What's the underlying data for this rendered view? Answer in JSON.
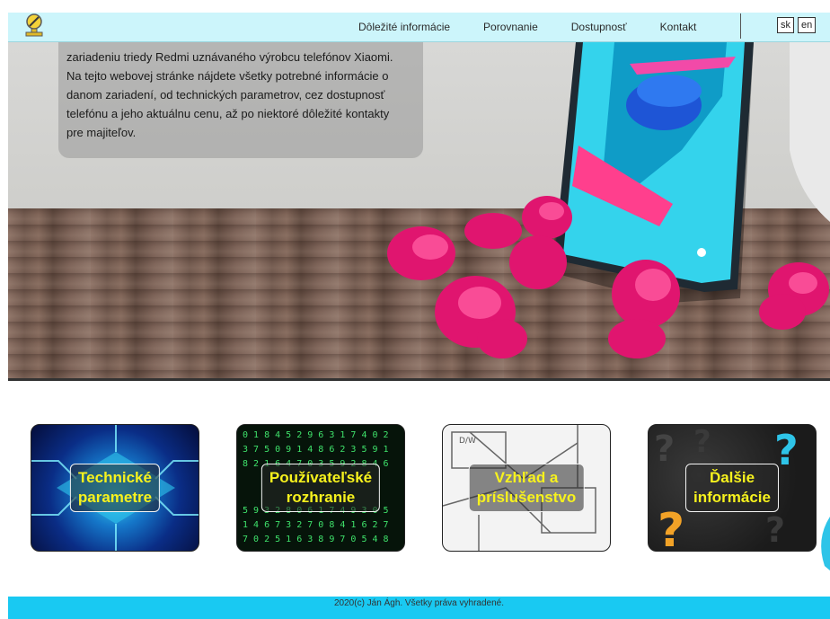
{
  "nav": {
    "links": [
      "Dôležité informácie",
      "Porovnanie",
      "Dostupnosť",
      "Kontakt"
    ],
    "languages": [
      "sk",
      "en"
    ]
  },
  "hero": {
    "intro_lines": [
      "zariadeniu triedy Redmi uznávaného výrobcu telefónov Xiaomi.",
      "Na tejto webovej stránke nájdete všetky potrebné informácie o",
      "danom zariadení, od technických parametrov, cez dostupnosť",
      "telefónu a jeho aktuálnu cenu, až po niektoré dôležité kontakty",
      "pre majiteľov."
    ]
  },
  "cards": [
    {
      "line1": "Technické",
      "line2": "parametre"
    },
    {
      "line1": "Používateľské",
      "line2": "rozhranie"
    },
    {
      "line1": "Vzhľad a",
      "line2": "príslušenstvo"
    },
    {
      "line1": "Ďalšie",
      "line2": "informácie"
    }
  ],
  "footer": {
    "text": "2020(c) Ján Ágh. Všetky práva vyhradené."
  },
  "colors": {
    "nav_bg": "#ccf5fb",
    "footer_bg": "#19c9f2",
    "card_label": "#f7f21d",
    "phone_accent": "#2ec4e8",
    "petals": "#e0156f"
  }
}
